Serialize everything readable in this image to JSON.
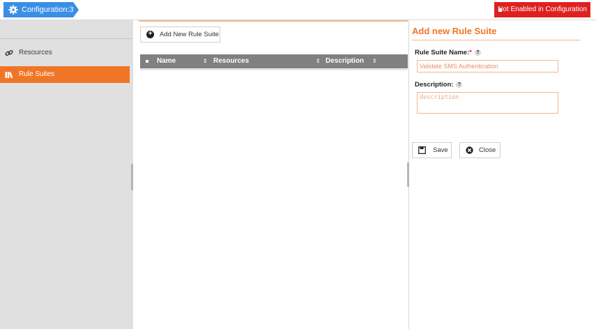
{
  "header": {
    "config_label": "Configuration:3",
    "status_label": "Not Enabled in Configuration"
  },
  "sidebar": {
    "items": [
      {
        "label": "Resources",
        "icon": "link-icon",
        "active": false
      },
      {
        "label": "Rule Suites",
        "icon": "books-icon",
        "active": true
      }
    ]
  },
  "list": {
    "add_button": "Add New Rule Suite",
    "columns": [
      "Name",
      "Resources",
      "Description"
    ]
  },
  "form": {
    "title": "Add new Rule Suite",
    "name_label": "Rule Suite Name:",
    "required_mark": "*",
    "help_mark": "?",
    "name_value": "Validate SMS Authentication",
    "description_label": "Description:",
    "description_placeholder": "description",
    "save_label": "Save",
    "close_label": "Close"
  },
  "colors": {
    "accent": "#f07627",
    "badge": "#3a8ee6",
    "alert": "#e02020"
  }
}
